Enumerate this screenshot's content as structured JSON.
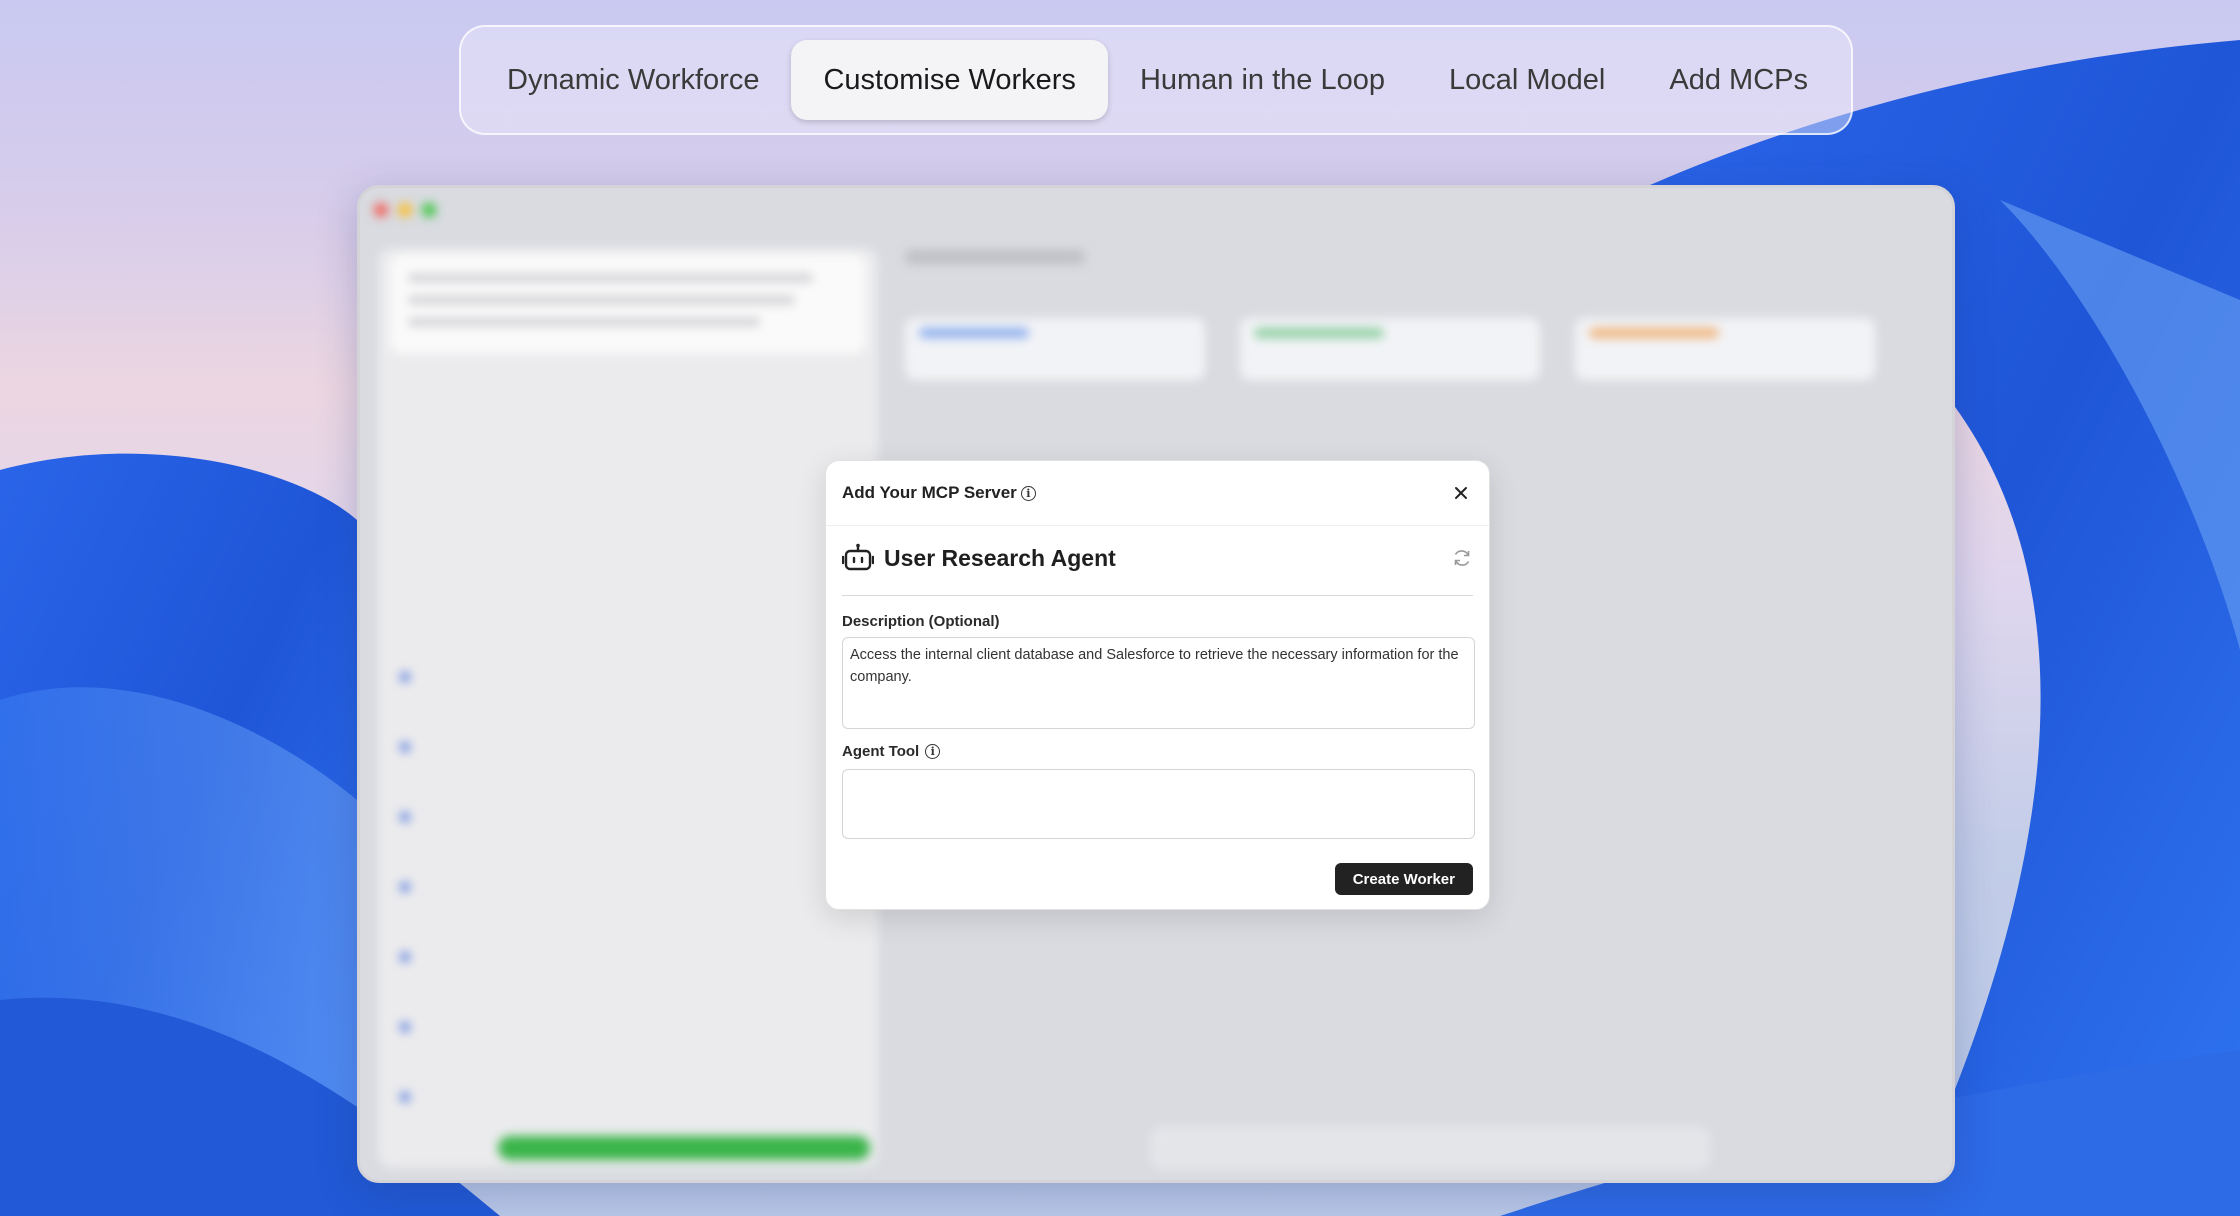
{
  "tabs": [
    {
      "label": "Dynamic Workforce",
      "active": false
    },
    {
      "label": "Customise Workers",
      "active": true
    },
    {
      "label": "Human in the Loop",
      "active": false
    },
    {
      "label": "Local Model",
      "active": false
    },
    {
      "label": "Add MCPs",
      "active": false
    }
  ],
  "modal": {
    "title": "Add Your MCP Server",
    "agent_name": "User Research Agent",
    "description_label": "Description (Optional)",
    "description_value": "Access the internal client database and Salesforce to retrieve the necessary information for the company.",
    "agent_tool_label": "Agent Tool",
    "agent_tool_value": "",
    "create_button": "Create Worker",
    "icons": {
      "info": "info-icon",
      "close": "close-icon",
      "agent": "robot-icon",
      "refresh": "refresh-icon"
    }
  },
  "colors": {
    "modal_button_bg": "#222222",
    "active_tab_bg": "#f4f3f6",
    "green_accent": "#3bb54a",
    "task_dot": "#5a7fe0"
  }
}
